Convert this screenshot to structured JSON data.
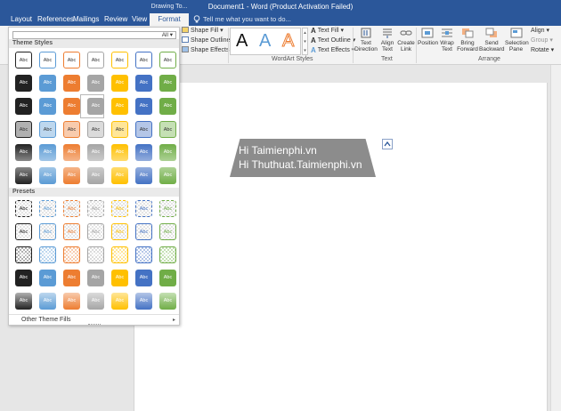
{
  "title_bar": {
    "context_tab_group": "Drawing To...",
    "document_title": "Document1 - Word (Product Activation Failed)"
  },
  "tabs": [
    "Layout",
    "References",
    "Mailings",
    "Review",
    "View",
    "Format"
  ],
  "active_tab": "Format",
  "tell_me": "Tell me what you want to do...",
  "ribbon": {
    "shape_fill": "Shape Fill",
    "shape_outline": "Shape Outline",
    "shape_effects": "Shape Effects",
    "wordart_letter": "A",
    "wordart_styles_label": "WordArt Styles",
    "text_fill": "Text Fill",
    "text_outline": "Text Outline",
    "text_effects": "Text Effects",
    "text_direction": "Text Direction",
    "align_text": "Align Text",
    "create_link": "Create Link",
    "text_group_label": "Text",
    "position": "Position",
    "wrap_text": "Wrap Text",
    "bring_forward": "Bring Forward",
    "send_backward": "Send Backward",
    "selection_pane": "Selection Pane",
    "align": "Align",
    "group": "Group",
    "rotate": "Rotate",
    "arrange_label": "Arrange",
    "dropdown_arrow": "▾"
  },
  "dropdown": {
    "filter_label": "All",
    "theme_styles_heading": "Theme Styles",
    "presets_heading": "Presets",
    "swatch_label": "Abc",
    "other_theme_fills": "Other Theme Fills",
    "submenu_arrow": "▸",
    "theme_colors": [
      "#222222",
      "#5b9bd5",
      "#ed7d31",
      "#a5a5a5",
      "#ffc000",
      "#4472c4",
      "#70ad47"
    ],
    "theme_light_tints": [
      "#b0b0b0",
      "#bdd7ee",
      "#f8cbad",
      "#dbdbdb",
      "#ffe699",
      "#b4c6e7",
      "#c5e0b4"
    ],
    "selected_swatch": "Abc, Gray, row 3"
  },
  "document": {
    "shape_line_1": "Hi Taimienphi.vn",
    "shape_line_2": "Hi Thuthuat.Taimienphi.vn",
    "shape_fill_color": "#8c8c8c"
  },
  "colors": {
    "ribbon_blue": "#2b579a",
    "ribbon_bg": "#f3f3f3"
  }
}
